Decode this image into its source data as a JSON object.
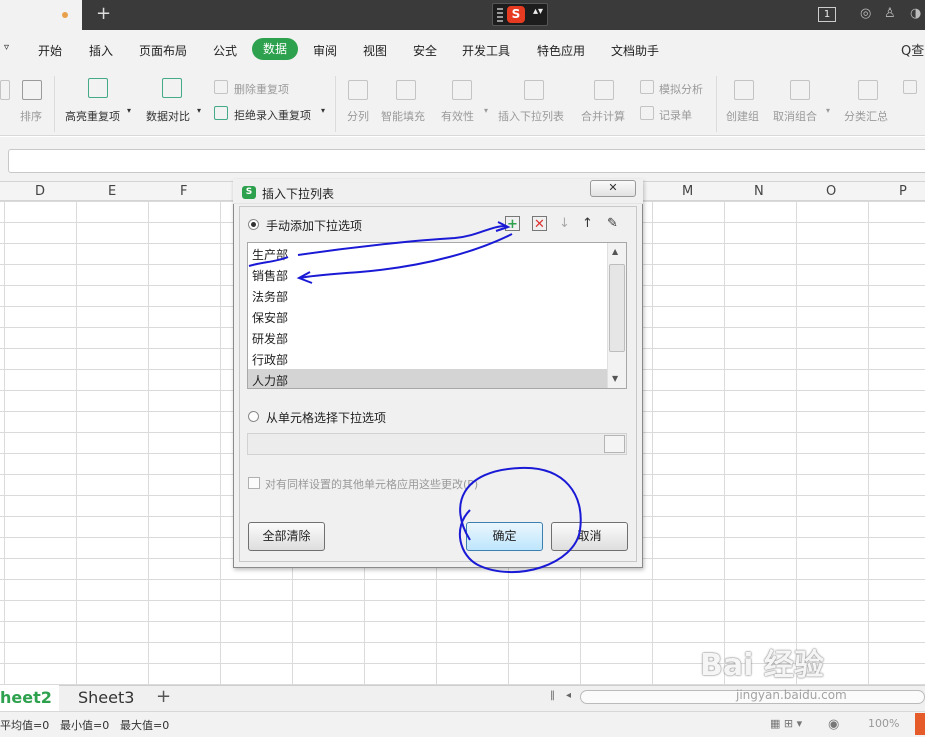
{
  "titlebar": {
    "plus": "+",
    "badge": "1"
  },
  "menu": {
    "items": [
      "开始",
      "插入",
      "页面布局",
      "公式",
      "数据",
      "审阅",
      "视图",
      "安全",
      "开发工具",
      "特色应用",
      "文档助手"
    ],
    "active": "数据",
    "search_label": "Q查"
  },
  "toolbar": {
    "sort": "排序",
    "highlight_dup": "高亮重复项",
    "compare": "数据对比",
    "delete_dup": "删除重复项",
    "reject_dup": "拒绝录入重复项",
    "split": "分列",
    "smart_fill": "智能填充",
    "validity": "有效性",
    "insert_dropdown": "插入下拉列表",
    "merge_calc": "合并计算",
    "simulate": "模拟分析",
    "record": "记录单",
    "create_group": "创建组",
    "ungroup": "取消组合",
    "subtotal": "分类汇总"
  },
  "columns": [
    "D",
    "E",
    "F",
    "M",
    "N",
    "O",
    "P"
  ],
  "dialog": {
    "title": "插入下拉列表",
    "manual_option": "手动添加下拉选项",
    "items": [
      "生产部",
      "销售部",
      "法务部",
      "保安部",
      "研发部",
      "行政部",
      "人力部"
    ],
    "selected_item": "人力部",
    "cell_option": "从单元格选择下拉选项",
    "apply_checkbox": "对有同样设置的其他单元格应用这些更改(P)",
    "clear_all": "全部清除",
    "ok": "确定",
    "cancel": "取消"
  },
  "sheets": {
    "active": "heet2",
    "other": "Sheet3",
    "add": "+"
  },
  "status": {
    "average": "平均值=0",
    "min": "最小值=0",
    "max": "最大值=0",
    "zoom": "100%"
  },
  "watermark": {
    "brand": "Bai 经验",
    "url": "jingyan.baidu.com"
  },
  "colors": {
    "accent_green": "#2ea14e",
    "annotation_blue": "#1a1ad6"
  }
}
